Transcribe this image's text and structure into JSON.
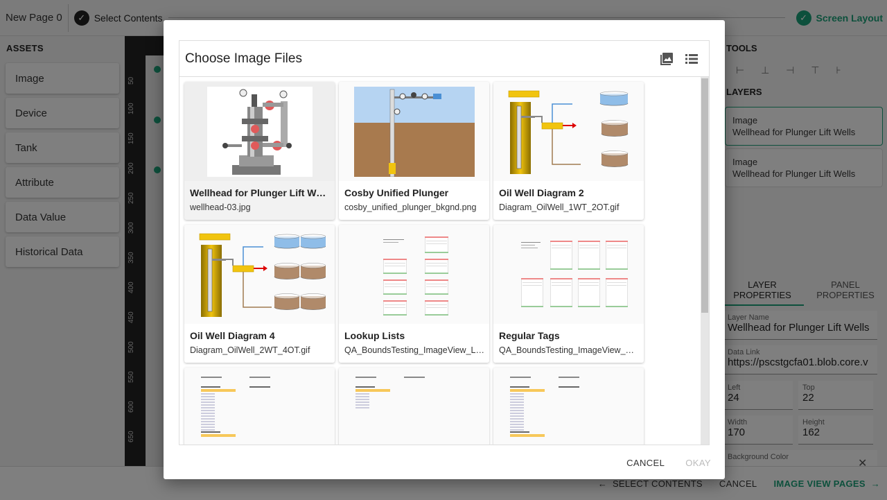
{
  "topbar": {
    "page_name": "New Page 0",
    "step1_label": "Select Contents",
    "step2_label": "Screen Layout"
  },
  "assets": {
    "heading": "ASSETS",
    "items": [
      "Image",
      "Device",
      "Tank",
      "Attribute",
      "Data Value",
      "Historical Data"
    ]
  },
  "ruler": {
    "ticks": [
      "50",
      "100",
      "150",
      "200",
      "250",
      "300",
      "350",
      "400",
      "450",
      "500",
      "550",
      "600",
      "650"
    ]
  },
  "right_panel": {
    "tools_heading": "TOOLS",
    "layers_heading": "LAYERS",
    "layers": [
      {
        "type": "Image",
        "name": "Wellhead for Plunger Lift Wells"
      },
      {
        "type": "Image",
        "name": "Wellhead for Plunger Lift Wells"
      }
    ],
    "tabs": [
      "LAYER PROPERTIES",
      "PANEL PROPERTIES"
    ],
    "fields": {
      "layer_name_label": "Layer Name",
      "layer_name": "Wellhead for Plunger Lift Wells",
      "data_link_label": "Data Link",
      "data_link": "https://pscstgcfa01.blob.core.v",
      "left_label": "Left",
      "left": "24",
      "top_label": "Top",
      "top": "22",
      "width_label": "Width",
      "width": "170",
      "height_label": "Height",
      "height": "162",
      "bg_color_label": "Background Color"
    }
  },
  "bottombar": {
    "back_label": "SELECT CONTENTS",
    "cancel_label": "CANCEL",
    "next_label": "IMAGE VIEW PAGES"
  },
  "dialog": {
    "title": "Choose Image Files",
    "cancel_label": "CANCEL",
    "okay_label": "OKAY",
    "images": [
      {
        "name": "Wellhead for Plunger Lift Wells",
        "file": "wellhead-03.jpg",
        "thumb": "wellhead"
      },
      {
        "name": "Cosby Unified Plunger",
        "file": "cosby_unified_plunger_bkgnd.png",
        "thumb": "plunger"
      },
      {
        "name": "Oil Well Diagram 2",
        "file": "Diagram_OilWell_1WT_2OT.gif",
        "thumb": "diagram2"
      },
      {
        "name": "Oil Well Diagram 4",
        "file": "Diagram_OilWell_2WT_4OT.gif",
        "thumb": "diagram4"
      },
      {
        "name": "Lookup Lists",
        "file": "QA_BoundsTesting_ImageView_Lookup",
        "thumb": "lookup"
      },
      {
        "name": "Regular Tags",
        "file": "QA_BoundsTesting_ImageView_Regular",
        "thumb": "regular"
      },
      {
        "name": "",
        "file": "",
        "thumb": "doc1"
      },
      {
        "name": "",
        "file": "",
        "thumb": "doc2"
      },
      {
        "name": "",
        "file": "",
        "thumb": "doc3"
      }
    ]
  },
  "colors": {
    "accent": "#1aa179",
    "tank_water": "#8fbde8",
    "tank_oil": "#b08a6a",
    "sky": "#b6d4f2",
    "ground": "#a87a4e",
    "gradient_yellow": "#f1c40f"
  }
}
